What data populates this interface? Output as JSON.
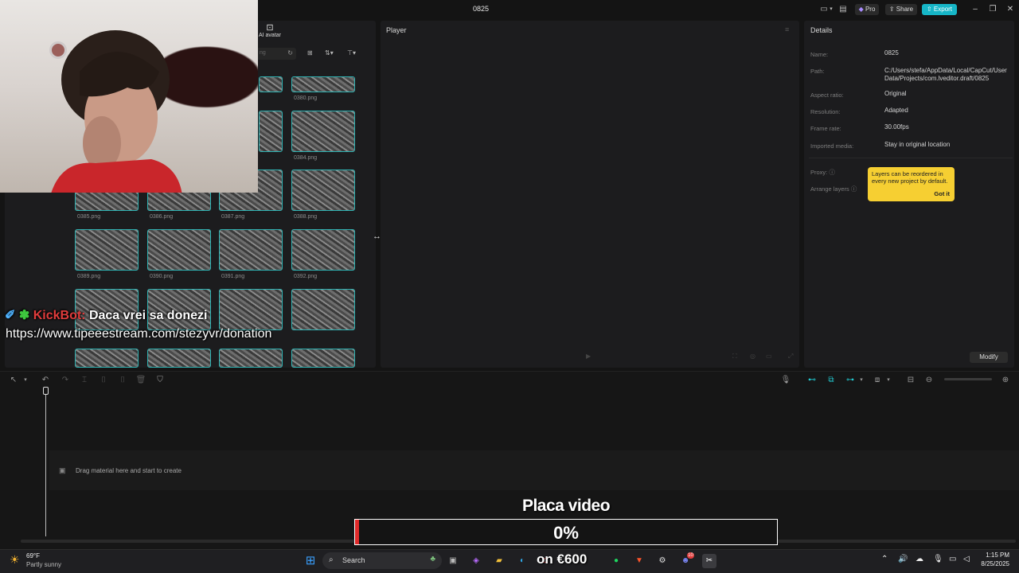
{
  "window": {
    "title": "0825"
  },
  "header": {
    "pro_label": "Pro",
    "share_label": "Share",
    "export_label": "Export"
  },
  "media": {
    "tab_ai_avatar": "AI avatar",
    "search_placeholder": "ng",
    "thumbs": [
      {
        "label": "0380.png"
      },
      {
        "label": "0384.png"
      },
      {
        "label": "0385.png"
      },
      {
        "label": "0386.png"
      },
      {
        "label": "0387.png"
      },
      {
        "label": "0388.png"
      },
      {
        "label": "0389.png"
      },
      {
        "label": "0390.png"
      },
      {
        "label": "0391.png"
      },
      {
        "label": "0392.png"
      }
    ]
  },
  "player": {
    "title": "Player"
  },
  "details": {
    "title": "Details",
    "rows": [
      {
        "key": "Name:",
        "value": "0825"
      },
      {
        "key": "Path:",
        "value": "C:/Users/stefa/AppData/Local/CapCut/User Data/Projects/com.lveditor.draft/0825"
      },
      {
        "key": "Aspect ratio:",
        "value": "Original"
      },
      {
        "key": "Resolution:",
        "value": "Adapted"
      },
      {
        "key": "Frame rate:",
        "value": "30.00fps"
      },
      {
        "key": "Imported media:",
        "value": "Stay in original location"
      }
    ],
    "proxy_label": "Proxy:",
    "arrange_label": "Arrange layers",
    "tooltip_text": "Layers can be reordered in every new project by default.",
    "tooltip_button": "Got it",
    "modify_label": "Modify"
  },
  "timeline": {
    "drop_hint": "Drag material here and start to create"
  },
  "overlay": {
    "chat_user": "KickBot:",
    "chat_message": "Daca vrei sa donezi",
    "chat_link": "https://www.tipeeestream.com/stezyvr/donation",
    "donation_title": "Placa video",
    "donation_percent": "0%",
    "donation_progress": 0.01,
    "goal_text": "on €600"
  },
  "taskbar": {
    "weather_temp": "69°F",
    "weather_desc": "Partly sunny",
    "search_label": "Search",
    "time": "1:15 PM",
    "date": "8/25/2025",
    "discord_badge": "10"
  },
  "colors": {
    "accent": "#16b6c7",
    "tooltip": "#f6cf32",
    "thumb_border": "#2fb3b3",
    "progress": "#e02a2a"
  }
}
